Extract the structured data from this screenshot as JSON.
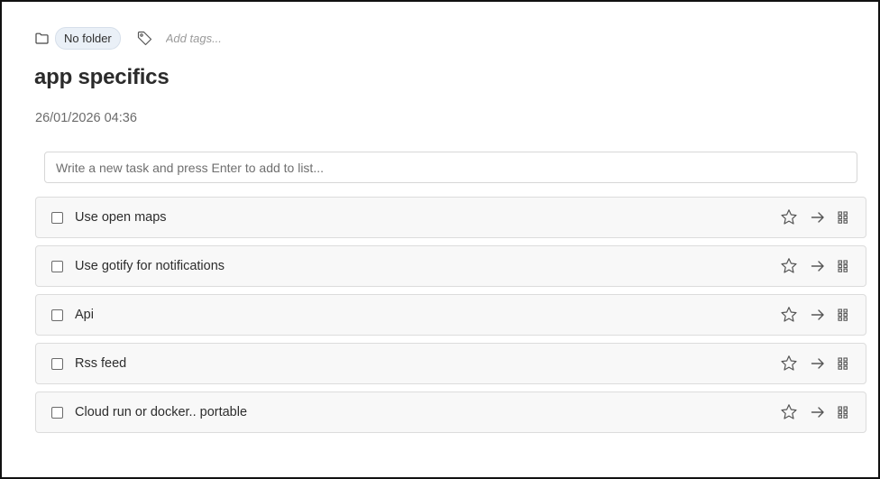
{
  "header": {
    "folder_label": "No folder",
    "tags_placeholder": "Add tags..."
  },
  "note": {
    "title": "app specifics",
    "timestamp": "26/01/2026 04:36"
  },
  "new_task": {
    "placeholder": "Write a new task and press Enter to add to list..."
  },
  "tasks": [
    {
      "label": "Use open maps",
      "checked": false,
      "starred": false
    },
    {
      "label": "Use gotify for notifications",
      "checked": false,
      "starred": false
    },
    {
      "label": "Api",
      "checked": false,
      "starred": false
    },
    {
      "label": "Rss feed",
      "checked": false,
      "starred": false
    },
    {
      "label": "Cloud run or docker.. portable",
      "checked": false,
      "starred": false
    }
  ],
  "icons": {
    "folder": "folder-icon",
    "tag": "tag-icon",
    "star": "star-icon",
    "move": "arrow-right-icon",
    "drag": "drag-handle-icon"
  }
}
